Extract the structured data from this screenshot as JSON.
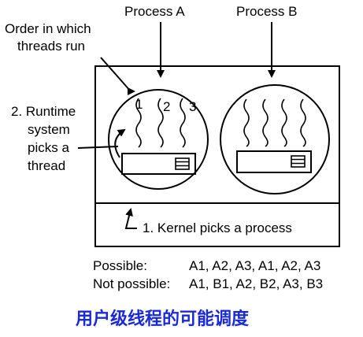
{
  "labels": {
    "process_a": "Process A",
    "process_b": "Process B",
    "order_line1": "Order in which",
    "order_line2": "threads run",
    "runtime_line1": "2. Runtime",
    "runtime_line2": "system",
    "runtime_line3": "picks a",
    "runtime_line4": "thread",
    "kernel": "1. Kernel picks a process",
    "thread_num_1": "1",
    "thread_num_2": "2",
    "thread_num_3": "3"
  },
  "legend": {
    "possible_label": "Possible:",
    "possible_value": "A1, A2, A3, A1, A2, A3",
    "not_possible_label": "Not possible:",
    "not_possible_value": "A1, B1, A2, B2, A3, B3"
  },
  "caption": "用户级线程的可能调度",
  "colors": {
    "caption": "#1a2bd6",
    "stroke": "#000000"
  }
}
